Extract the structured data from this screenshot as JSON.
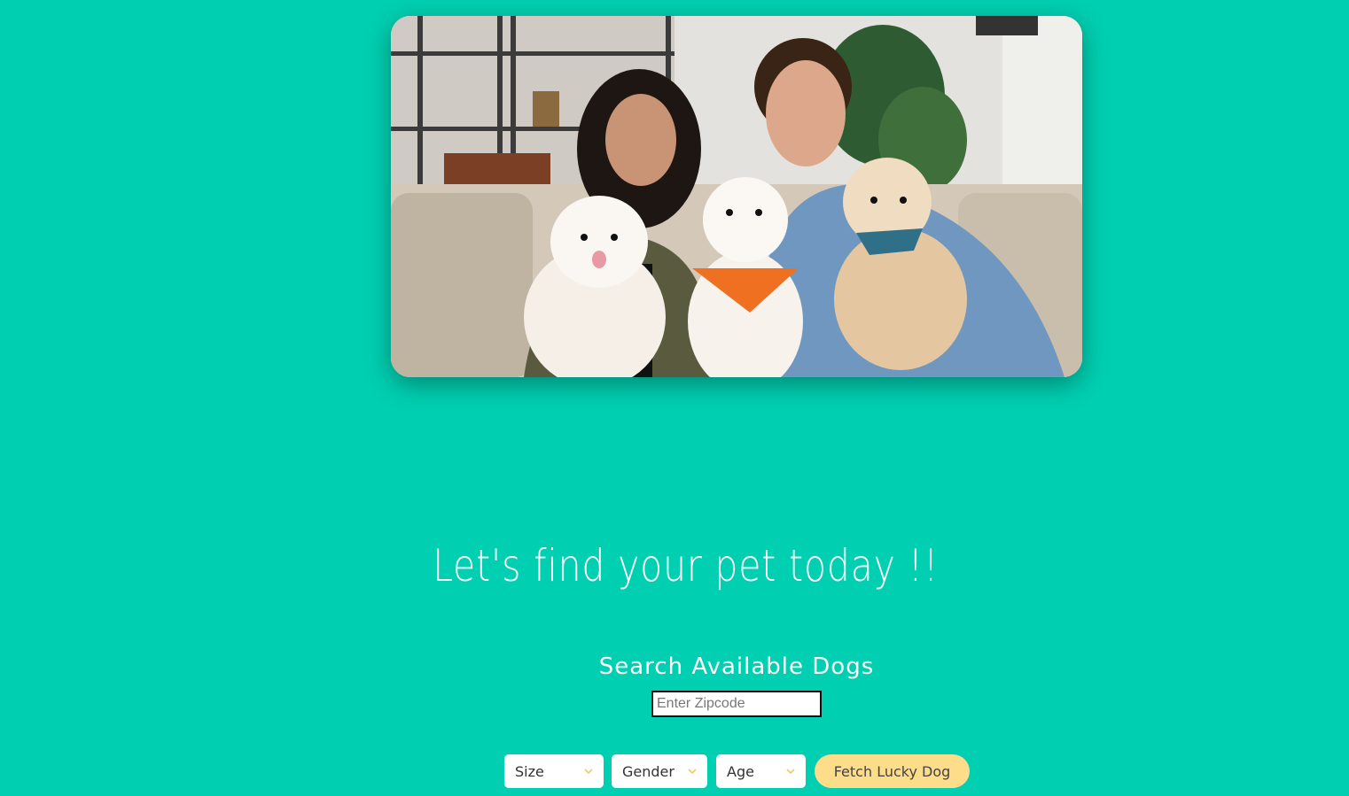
{
  "hero": {
    "image_description_icon": "family-with-dogs-photo"
  },
  "tagline": "Let's find your pet today !!",
  "search": {
    "title": "Search Available Dogs",
    "zip_placeholder": "Enter Zipcode"
  },
  "filters": {
    "size_label": "Size",
    "gender_label": "Gender",
    "age_label": "Age"
  },
  "fetch_button": "Fetch Lucky Dog",
  "colors": {
    "background": "#00cfb1",
    "button": "#fddc8a",
    "chevron": "#f5c96a",
    "text_light": "#ffffff"
  }
}
